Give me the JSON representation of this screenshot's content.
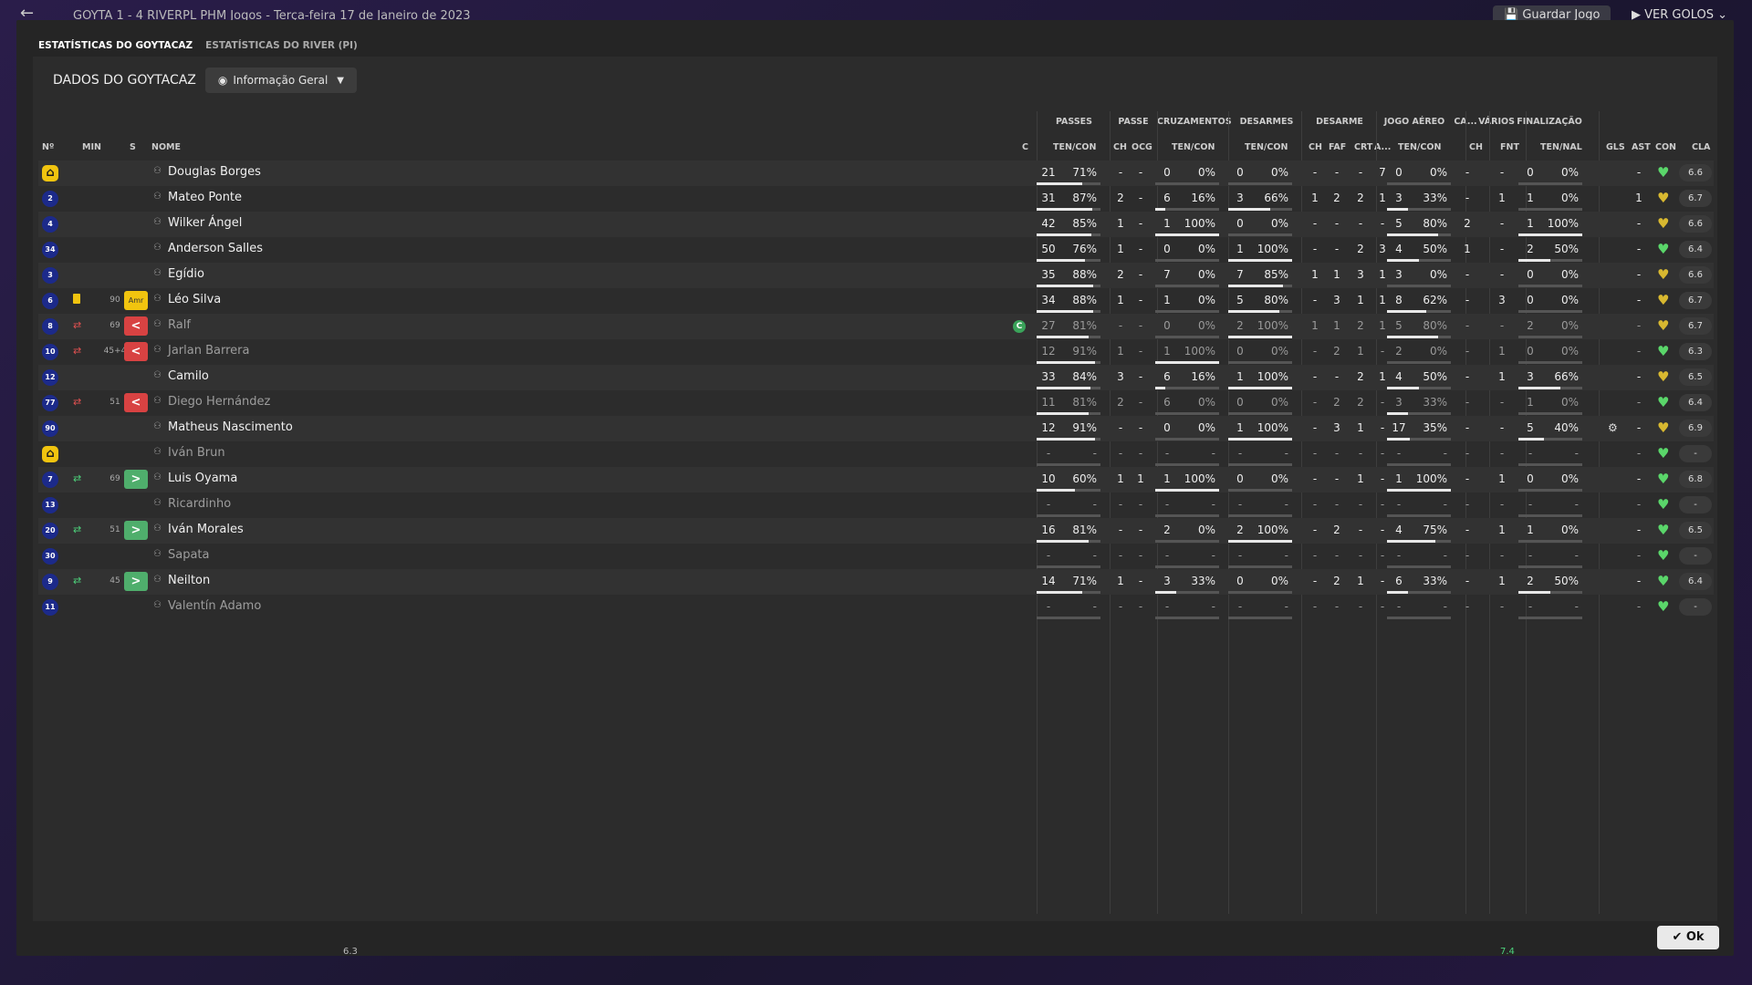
{
  "topbar": {
    "title": "GOYTA 1 - 4 RIVERPL PHM Jogos - Terça-feira 17 de Janeiro de 2023",
    "save_label": "Guardar Jogo",
    "goals_label": "VER GOLOS"
  },
  "tabs": [
    {
      "label": "ESTATÍSTICAS DO GOYTACAZ",
      "active": true
    },
    {
      "label": "ESTATÍSTICAS DO RIVER (PI)",
      "active": false
    }
  ],
  "panel": {
    "title": "DADOS DO GOYTACAZ",
    "view_select": "Informação Geral"
  },
  "groups": [
    "PASSES",
    "PASSE",
    "CRUZAMENTOS",
    "DESARMES",
    "DESARME",
    "JOGO AÉREO",
    "CA...",
    "VÁRIOS",
    "FINALIZAÇÃO"
  ],
  "headers": {
    "num": "Nº",
    "min": "MIN",
    "s": "S",
    "name": "NOME",
    "c": "C",
    "pass_tc": "TEN/CON",
    "pass_ch": "CH",
    "pass_ocg": "OCG",
    "cross_tc": "TEN/CON",
    "tack_tc": "TEN/CON",
    "des_ch": "CH",
    "des_faf": "FAF",
    "des_crt": "CRT",
    "des_a": "A...",
    "aer_tc": "TEN/CON",
    "ca_ch": "CH",
    "var_fnt": "FNT",
    "fin_tn": "TEN/NAL",
    "gls": "GLS",
    "ast": "AST",
    "con": "CON",
    "cla": "CLA"
  },
  "players": [
    {
      "num": "GK",
      "gk": true,
      "min": "",
      "s": "",
      "evt": "",
      "name": "Douglas Borges",
      "dim": false,
      "cap": false,
      "p": [
        "21",
        "71%"
      ],
      "pch": "-",
      "pocg": "-",
      "cr": [
        "0",
        "0%"
      ],
      "tk": [
        "0",
        "0%"
      ],
      "ch": "-",
      "faf": "-",
      "crt": "-",
      "a": "7",
      "ae": [
        "0",
        "0%"
      ],
      "cach": "-",
      "fnt": "-",
      "fin": [
        "0",
        "0%"
      ],
      "gls": "",
      "ast": "-",
      "con": "green",
      "cla": "6.6",
      "gear": false,
      "pf": 0.71,
      "crf": 0,
      "tkf": 0,
      "aef": 0,
      "finf": 0
    },
    {
      "num": "2",
      "gk": false,
      "min": "",
      "s": "",
      "evt": "",
      "name": "Mateo Ponte",
      "dim": false,
      "cap": false,
      "p": [
        "31",
        "87%"
      ],
      "pch": "2",
      "pocg": "-",
      "cr": [
        "6",
        "16%"
      ],
      "tk": [
        "3",
        "66%"
      ],
      "ch": "1",
      "faf": "2",
      "crt": "2",
      "a": "1",
      "ae": [
        "3",
        "33%"
      ],
      "cach": "-",
      "fnt": "1",
      "fin": [
        "1",
        "0%"
      ],
      "gls": "",
      "ast": "1",
      "con": "gold",
      "cla": "6.7",
      "gear": false,
      "pf": 0.87,
      "crf": 0.16,
      "tkf": 0.66,
      "aef": 0.33,
      "finf": 0
    },
    {
      "num": "4",
      "gk": false,
      "min": "",
      "s": "",
      "evt": "",
      "name": "Wilker Ángel",
      "dim": false,
      "cap": false,
      "p": [
        "42",
        "85%"
      ],
      "pch": "1",
      "pocg": "-",
      "cr": [
        "1",
        "100%"
      ],
      "tk": [
        "0",
        "0%"
      ],
      "ch": "-",
      "faf": "-",
      "crt": "-",
      "a": "-",
      "ae": [
        "5",
        "80%"
      ],
      "cach": "2",
      "fnt": "-",
      "fin": [
        "1",
        "100%"
      ],
      "gls": "",
      "ast": "-",
      "con": "gold",
      "cla": "6.6",
      "gear": false,
      "pf": 0.85,
      "crf": 1,
      "tkf": 0,
      "aef": 0.8,
      "finf": 1
    },
    {
      "num": "34",
      "gk": false,
      "min": "",
      "s": "",
      "evt": "",
      "name": "Anderson Salles",
      "dim": false,
      "cap": false,
      "p": [
        "50",
        "76%"
      ],
      "pch": "1",
      "pocg": "-",
      "cr": [
        "0",
        "0%"
      ],
      "tk": [
        "1",
        "100%"
      ],
      "ch": "-",
      "faf": "-",
      "crt": "2",
      "a": "3",
      "ae": [
        "4",
        "50%"
      ],
      "cach": "1",
      "fnt": "-",
      "fin": [
        "2",
        "50%"
      ],
      "gls": "",
      "ast": "-",
      "con": "green",
      "cla": "6.4",
      "gear": false,
      "pf": 0.76,
      "crf": 0,
      "tkf": 1,
      "aef": 0.5,
      "finf": 0.5
    },
    {
      "num": "3",
      "gk": false,
      "min": "",
      "s": "",
      "evt": "",
      "name": "Egídio",
      "dim": false,
      "cap": false,
      "p": [
        "35",
        "88%"
      ],
      "pch": "2",
      "pocg": "-",
      "cr": [
        "7",
        "0%"
      ],
      "tk": [
        "7",
        "85%"
      ],
      "ch": "1",
      "faf": "1",
      "crt": "3",
      "a": "1",
      "ae": [
        "3",
        "0%"
      ],
      "cach": "-",
      "fnt": "-",
      "fin": [
        "0",
        "0%"
      ],
      "gls": "",
      "ast": "-",
      "con": "gold",
      "cla": "6.6",
      "gear": false,
      "pf": 0.88,
      "crf": 0,
      "tkf": 0.85,
      "aef": 0,
      "finf": 0
    },
    {
      "num": "6",
      "gk": false,
      "min": "90",
      "s": "Amr",
      "evt": "yc",
      "name": "Léo Silva",
      "dim": false,
      "cap": false,
      "p": [
        "34",
        "88%"
      ],
      "pch": "1",
      "pocg": "-",
      "cr": [
        "1",
        "0%"
      ],
      "tk": [
        "5",
        "80%"
      ],
      "ch": "-",
      "faf": "3",
      "crt": "1",
      "a": "1",
      "ae": [
        "8",
        "62%"
      ],
      "cach": "-",
      "fnt": "3",
      "fin": [
        "0",
        "0%"
      ],
      "gls": "",
      "ast": "-",
      "con": "gold",
      "cla": "6.7",
      "gear": false,
      "pf": 0.88,
      "crf": 0,
      "tkf": 0.8,
      "aef": 0.62,
      "finf": 0
    },
    {
      "num": "8",
      "gk": false,
      "min": "69",
      "s": "<",
      "evt": "out",
      "name": "Ralf",
      "dim": true,
      "cap": true,
      "p": [
        "27",
        "81%"
      ],
      "pch": "-",
      "pocg": "-",
      "cr": [
        "0",
        "0%"
      ],
      "tk": [
        "2",
        "100%"
      ],
      "ch": "1",
      "faf": "1",
      "crt": "2",
      "a": "1",
      "ae": [
        "5",
        "80%"
      ],
      "cach": "-",
      "fnt": "-",
      "fin": [
        "2",
        "0%"
      ],
      "gls": "",
      "ast": "-",
      "con": "gold",
      "cla": "6.7",
      "gear": false,
      "pf": 0.81,
      "crf": 0,
      "tkf": 1,
      "aef": 0.8,
      "finf": 0
    },
    {
      "num": "10",
      "gk": false,
      "min": "45+4",
      "s": "<",
      "evt": "out",
      "name": "Jarlan Barrera",
      "dim": true,
      "cap": false,
      "p": [
        "12",
        "91%"
      ],
      "pch": "1",
      "pocg": "-",
      "cr": [
        "1",
        "100%"
      ],
      "tk": [
        "0",
        "0%"
      ],
      "ch": "-",
      "faf": "2",
      "crt": "1",
      "a": "-",
      "ae": [
        "2",
        "0%"
      ],
      "cach": "-",
      "fnt": "1",
      "fin": [
        "0",
        "0%"
      ],
      "gls": "",
      "ast": "-",
      "con": "green",
      "cla": "6.3",
      "gear": false,
      "pf": 0.91,
      "crf": 1,
      "tkf": 0,
      "aef": 0,
      "finf": 0
    },
    {
      "num": "12",
      "gk": false,
      "min": "",
      "s": "",
      "evt": "",
      "name": "Camilo",
      "dim": false,
      "cap": false,
      "p": [
        "33",
        "84%"
      ],
      "pch": "3",
      "pocg": "-",
      "cr": [
        "6",
        "16%"
      ],
      "tk": [
        "1",
        "100%"
      ],
      "ch": "-",
      "faf": "-",
      "crt": "2",
      "a": "1",
      "ae": [
        "4",
        "50%"
      ],
      "cach": "-",
      "fnt": "1",
      "fin": [
        "3",
        "66%"
      ],
      "gls": "",
      "ast": "-",
      "con": "gold",
      "cla": "6.5",
      "gear": false,
      "pf": 0.84,
      "crf": 0.16,
      "tkf": 1,
      "aef": 0.5,
      "finf": 0.66
    },
    {
      "num": "77",
      "gk": false,
      "min": "51",
      "s": "<",
      "evt": "out",
      "name": "Diego Hernández",
      "dim": true,
      "cap": false,
      "p": [
        "11",
        "81%"
      ],
      "pch": "2",
      "pocg": "-",
      "cr": [
        "6",
        "0%"
      ],
      "tk": [
        "0",
        "0%"
      ],
      "ch": "-",
      "faf": "2",
      "crt": "2",
      "a": "-",
      "ae": [
        "3",
        "33%"
      ],
      "cach": "-",
      "fnt": "-",
      "fin": [
        "1",
        "0%"
      ],
      "gls": "",
      "ast": "-",
      "con": "green",
      "cla": "6.4",
      "gear": false,
      "pf": 0.81,
      "crf": 0,
      "tkf": 0,
      "aef": 0.33,
      "finf": 0
    },
    {
      "num": "90",
      "gk": false,
      "min": "",
      "s": "",
      "evt": "",
      "name": "Matheus Nascimento",
      "dim": false,
      "cap": false,
      "p": [
        "12",
        "91%"
      ],
      "pch": "-",
      "pocg": "-",
      "cr": [
        "0",
        "0%"
      ],
      "tk": [
        "1",
        "100%"
      ],
      "ch": "-",
      "faf": "3",
      "crt": "1",
      "a": "-",
      "ae": [
        "17",
        "35%"
      ],
      "cach": "-",
      "fnt": "-",
      "fin": [
        "5",
        "40%"
      ],
      "gls": "",
      "ast": "-",
      "con": "gold",
      "cla": "6.9",
      "gear": true,
      "pf": 0.91,
      "crf": 0,
      "tkf": 1,
      "aef": 0.35,
      "finf": 0.4
    },
    {
      "num": "GK",
      "gk": true,
      "min": "",
      "s": "",
      "evt": "",
      "name": "Iván Brun",
      "dim": true,
      "cap": false,
      "p": [
        "-",
        "-"
      ],
      "pch": "-",
      "pocg": "-",
      "cr": [
        "-",
        "-"
      ],
      "tk": [
        "-",
        "-"
      ],
      "ch": "-",
      "faf": "-",
      "crt": "-",
      "a": "-",
      "ae": [
        "-",
        "-"
      ],
      "cach": "-",
      "fnt": "-",
      "fin": [
        "-",
        "-"
      ],
      "gls": "",
      "ast": "-",
      "con": "green",
      "cla": "-",
      "gear": false,
      "pf": 0,
      "crf": 0,
      "tkf": 0,
      "aef": 0,
      "finf": 0
    },
    {
      "num": "7",
      "gk": false,
      "min": "69",
      "s": ">",
      "evt": "in",
      "name": "Luis Oyama",
      "dim": false,
      "cap": false,
      "p": [
        "10",
        "60%"
      ],
      "pch": "1",
      "pocg": "1",
      "cr": [
        "1",
        "100%"
      ],
      "tk": [
        "0",
        "0%"
      ],
      "ch": "-",
      "faf": "-",
      "crt": "1",
      "a": "-",
      "ae": [
        "1",
        "100%"
      ],
      "cach": "-",
      "fnt": "1",
      "fin": [
        "0",
        "0%"
      ],
      "gls": "",
      "ast": "-",
      "con": "green",
      "cla": "6.8",
      "gear": false,
      "pf": 0.6,
      "crf": 1,
      "tkf": 0,
      "aef": 1,
      "finf": 0
    },
    {
      "num": "13",
      "gk": false,
      "min": "",
      "s": "",
      "evt": "",
      "name": "Ricardinho",
      "dim": true,
      "cap": false,
      "p": [
        "-",
        "-"
      ],
      "pch": "-",
      "pocg": "-",
      "cr": [
        "-",
        "-"
      ],
      "tk": [
        "-",
        "-"
      ],
      "ch": "-",
      "faf": "-",
      "crt": "-",
      "a": "-",
      "ae": [
        "-",
        "-"
      ],
      "cach": "-",
      "fnt": "-",
      "fin": [
        "-",
        "-"
      ],
      "gls": "",
      "ast": "-",
      "con": "green",
      "cla": "-",
      "gear": false,
      "pf": 0,
      "crf": 0,
      "tkf": 0,
      "aef": 0,
      "finf": 0
    },
    {
      "num": "20",
      "gk": false,
      "min": "51",
      "s": ">",
      "evt": "in",
      "name": "Iván Morales",
      "dim": false,
      "cap": false,
      "p": [
        "16",
        "81%"
      ],
      "pch": "-",
      "pocg": "-",
      "cr": [
        "2",
        "0%"
      ],
      "tk": [
        "2",
        "100%"
      ],
      "ch": "-",
      "faf": "2",
      "crt": "-",
      "a": "-",
      "ae": [
        "4",
        "75%"
      ],
      "cach": "-",
      "fnt": "1",
      "fin": [
        "1",
        "0%"
      ],
      "gls": "",
      "ast": "-",
      "con": "green",
      "cla": "6.5",
      "gear": false,
      "pf": 0.81,
      "crf": 0,
      "tkf": 1,
      "aef": 0.75,
      "finf": 0
    },
    {
      "num": "30",
      "gk": false,
      "min": "",
      "s": "",
      "evt": "",
      "name": "Sapata",
      "dim": true,
      "cap": false,
      "p": [
        "-",
        "-"
      ],
      "pch": "-",
      "pocg": "-",
      "cr": [
        "-",
        "-"
      ],
      "tk": [
        "-",
        "-"
      ],
      "ch": "-",
      "faf": "-",
      "crt": "-",
      "a": "-",
      "ae": [
        "-",
        "-"
      ],
      "cach": "-",
      "fnt": "-",
      "fin": [
        "-",
        "-"
      ],
      "gls": "",
      "ast": "-",
      "con": "green",
      "cla": "-",
      "gear": false,
      "pf": 0,
      "crf": 0,
      "tkf": 0,
      "aef": 0,
      "finf": 0
    },
    {
      "num": "9",
      "gk": false,
      "min": "45",
      "s": ">",
      "evt": "in",
      "name": "Neilton",
      "dim": false,
      "cap": false,
      "p": [
        "14",
        "71%"
      ],
      "pch": "1",
      "pocg": "-",
      "cr": [
        "3",
        "33%"
      ],
      "tk": [
        "0",
        "0%"
      ],
      "ch": "-",
      "faf": "2",
      "crt": "1",
      "a": "-",
      "ae": [
        "6",
        "33%"
      ],
      "cach": "-",
      "fnt": "1",
      "fin": [
        "2",
        "50%"
      ],
      "gls": "",
      "ast": "-",
      "con": "green",
      "cla": "6.4",
      "gear": false,
      "pf": 0.71,
      "crf": 0.33,
      "tkf": 0,
      "aef": 0.33,
      "finf": 0.5
    },
    {
      "num": "11",
      "gk": false,
      "min": "",
      "s": "",
      "evt": "",
      "name": "Valentín Adamo",
      "dim": true,
      "cap": false,
      "p": [
        "-",
        "-"
      ],
      "pch": "-",
      "pocg": "-",
      "cr": [
        "-",
        "-"
      ],
      "tk": [
        "-",
        "-"
      ],
      "ch": "-",
      "faf": "-",
      "crt": "-",
      "a": "-",
      "ae": [
        "-",
        "-"
      ],
      "cach": "-",
      "fnt": "-",
      "fin": [
        "-",
        "-"
      ],
      "gls": "",
      "ast": "-",
      "con": "green",
      "cla": "-",
      "gear": false,
      "pf": 0,
      "crf": 0,
      "tkf": 0,
      "aef": 0,
      "finf": 0
    }
  ],
  "captain_badge": "C",
  "ok_label": "Ok",
  "bottom": {
    "rating_a": "6.3",
    "rating_b": "7.4"
  },
  "colors": {
    "accent_green": "#5ad66a",
    "accent_gold": "#d8b830",
    "out_red": "#d84242",
    "in_green": "#4fae6c"
  }
}
